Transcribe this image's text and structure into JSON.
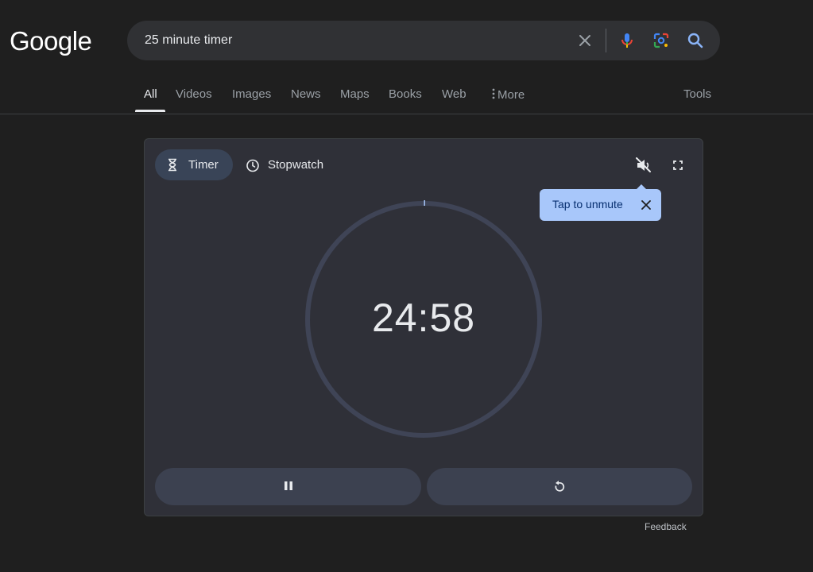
{
  "logo": "Google",
  "search": {
    "value": "25 minute timer"
  },
  "icons": {
    "clear": "close-icon",
    "voice": "microphone-icon",
    "lens": "google-lens-icon",
    "search": "search-icon"
  },
  "tabs": {
    "items": [
      {
        "label": "All",
        "active": true
      },
      {
        "label": "Videos"
      },
      {
        "label": "Images"
      },
      {
        "label": "News"
      },
      {
        "label": "Maps"
      },
      {
        "label": "Books"
      },
      {
        "label": "Web"
      },
      {
        "label": "More"
      }
    ],
    "tools": "Tools"
  },
  "timer_card": {
    "modes": {
      "timer": "Timer",
      "stopwatch": "Stopwatch",
      "selected": "Timer"
    },
    "tooltip": "Tap to unmute",
    "time": "24:58",
    "progress_elapsed_fraction": 0.0013,
    "buttons": {
      "pause": "pause-icon",
      "reset": "reset-icon"
    }
  },
  "feedback": "Feedback",
  "colors": {
    "background": "#1f1f1f",
    "card": "#2f3038",
    "accent": "#a8c7fa",
    "active_chip": "#394457"
  }
}
